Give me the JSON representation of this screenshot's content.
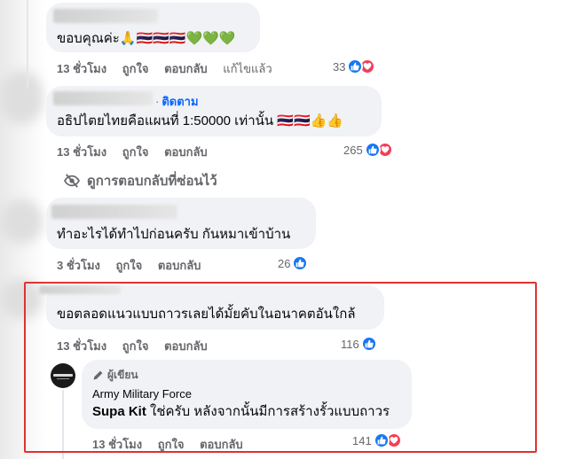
{
  "comments": [
    {
      "text": "ขอบคุณค่ะ🙏🇹🇭🇹🇭🇹🇭💚💚💚",
      "time": "13 ชั่วโมง",
      "like": "ถูกใจ",
      "reply": "ตอบกลับ",
      "edited": "แก้ไขแล้ว",
      "reaction_count": "33",
      "reactions": [
        "like",
        "love"
      ]
    },
    {
      "follow_label": "ติดตาม",
      "text": "อธิปไตยไทยคือแผนที่ 1:50000 เท่านั้น 🇹🇭🇹🇭👍👍",
      "time": "13 ชั่วโมง",
      "like": "ถูกใจ",
      "reply": "ตอบกลับ",
      "reaction_count": "265",
      "reactions": [
        "like",
        "love"
      ]
    },
    {
      "text": "ทำอะไรได้ทำไปก่อนครับ กันหมาเข้าบ้าน",
      "time": "3 ชั่วโมง",
      "like": "ถูกใจ",
      "reply": "ตอบกลับ",
      "reaction_count": "26",
      "reactions": [
        "like"
      ]
    },
    {
      "text": "ขอตลอดแนวแบบถาวรเลยได้มั้ยคับในอนาคตอันใกล้",
      "time": "13 ชั่วโมง",
      "like": "ถูกใจ",
      "reply": "ตอบกลับ",
      "reaction_count": "116",
      "reactions": [
        "like"
      ]
    }
  ],
  "hidden_replies_label": "ดูการตอบกลับที่ซ่อนไว้",
  "author_reply": {
    "badge": "ผู้เขียน",
    "page_name": "Army Military Force",
    "mention": "Supa Kit",
    "text": " ใช่ครับ หลังจากนั้นมีการสร้างรั้วแบบถาวร",
    "time": "13 ชั่วโมง",
    "like": "ถูกใจ",
    "reply": "ตอบกลับ",
    "reaction_count": "141",
    "reactions": [
      "like",
      "love"
    ]
  },
  "colors": {
    "bubble": "#f0f2f5",
    "meta_text": "#65676b",
    "link_blue": "#0866ff",
    "like_blue": "#1877f2",
    "love_red": "#f33e58",
    "highlight_red": "#e03131"
  }
}
